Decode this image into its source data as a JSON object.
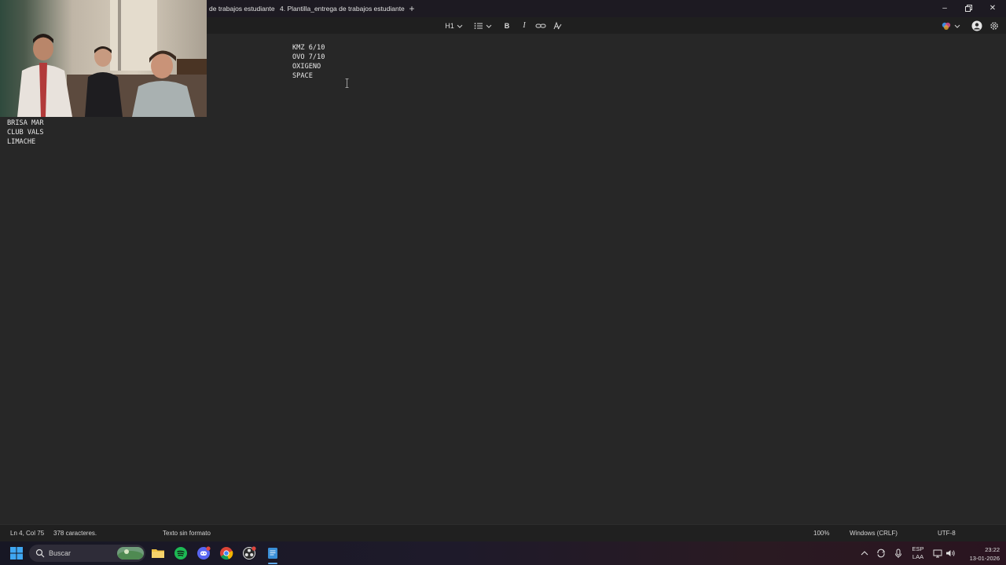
{
  "tabs": [
    {
      "label": "de trabajos estudiante"
    },
    {
      "label": "4. Plantilla_entrega de trabajos estudiante"
    }
  ],
  "toolbar": {
    "heading_label": "H1"
  },
  "editor": {
    "main_lines": [
      "KMZ 6/10",
      "OVO 7/10",
      "OXIGENO",
      "SPACE"
    ],
    "side_lines": [
      "BRISA MAR",
      "CLUB VALS",
      "LIMACHE"
    ]
  },
  "statusbar": {
    "position": "Ln 4, Col 75",
    "chars": "378 caracteres.",
    "format": "Texto sin formato",
    "zoom": "100%",
    "line_ending": "Windows (CRLF)",
    "encoding": "UTF-8"
  },
  "taskbar": {
    "search_label": "Buscar",
    "lang_top": "ESP",
    "lang_bottom": "LAA",
    "time": "23:22",
    "date": "13-01-2026"
  },
  "colors": {
    "editor_bg": "#272727",
    "titlebar_bg": "#1d1a22",
    "text": "#e8e8e8"
  }
}
